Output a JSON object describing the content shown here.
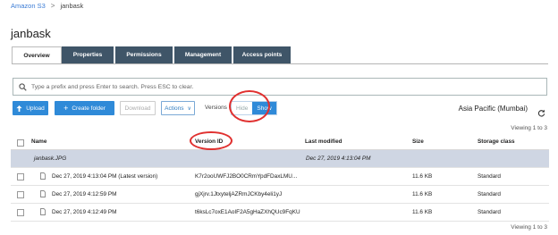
{
  "breadcrumb": {
    "root": "Amazon S3",
    "separator": ">",
    "current": "janbask"
  },
  "page_title": "janbask",
  "tabs": [
    {
      "label": "Overview"
    },
    {
      "label": "Properties"
    },
    {
      "label": "Permissions"
    },
    {
      "label": "Management"
    },
    {
      "label": "Access points"
    }
  ],
  "search": {
    "placeholder": "Type a prefix and press Enter to search. Press ESC to clear."
  },
  "toolbar": {
    "upload": "Upload",
    "create_folder": "Create folder",
    "download": "Download",
    "actions": "Actions",
    "versions_label": "Versions",
    "hide": "Hide",
    "show": "Show",
    "region": "Asia Pacific (Mumbai)"
  },
  "viewing_text": "Viewing 1 to 3",
  "table": {
    "headers": {
      "name": "Name",
      "version_id": "Version ID",
      "last_modified": "Last modified",
      "size": "Size",
      "storage_class": "Storage class"
    },
    "group": {
      "name": "janbask.JPG",
      "last_modified": "Dec 27, 2019 4:13:04 PM"
    },
    "rows": [
      {
        "name": "Dec 27, 2019 4:13:04 PM (Latest version)",
        "version_id": "K7r2ooUWFJ2BO0CRmYpdFDaxLMU...",
        "size": "11.6 KB",
        "storage_class": "Standard"
      },
      {
        "name": "Dec 27, 2019 4:12:59 PM",
        "version_id": "gjXjrv.1JtxyteljAZRmJCKby4eli1yJ",
        "size": "11.6 KB",
        "storage_class": "Standard"
      },
      {
        "name": "Dec 27, 2019 4:12:49 PM",
        "version_id": "t6ksLc7oxE1AoIF2A5gHaZXhQUc9FqKU",
        "size": "11.6 KB",
        "storage_class": "Standard"
      }
    ]
  },
  "colors": {
    "tab_bg": "#3f5568",
    "primary": "#2f8ad8",
    "group_row": "#cfd6e3",
    "annotation": "#e0302f"
  }
}
